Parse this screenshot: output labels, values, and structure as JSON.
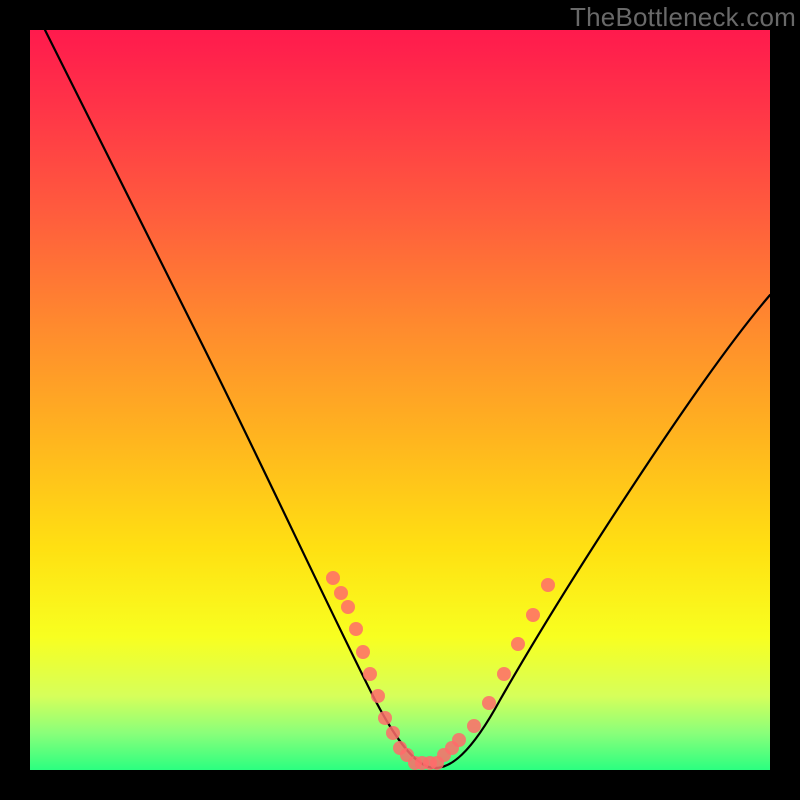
{
  "watermark": "TheBottleneck.com",
  "chart_data": {
    "type": "line",
    "title": "",
    "xlabel": "",
    "ylabel": "",
    "xlim": [
      0,
      100
    ],
    "ylim": [
      0,
      100
    ],
    "background_gradient": {
      "type": "vertical",
      "stops": [
        {
          "pos": 0,
          "color": "#ff1a4d"
        },
        {
          "pos": 25,
          "color": "#ff5d3d"
        },
        {
          "pos": 55,
          "color": "#ffb41f"
        },
        {
          "pos": 82,
          "color": "#f8ff20"
        },
        {
          "pos": 100,
          "color": "#2bff80"
        }
      ]
    },
    "series": [
      {
        "name": "bottleneck-curve",
        "x": [
          2,
          8,
          14,
          20,
          26,
          32,
          38,
          43,
          47,
          50,
          53,
          56,
          60,
          64,
          70,
          78,
          86,
          94,
          100
        ],
        "y": [
          100,
          90,
          79,
          67,
          56,
          44,
          33,
          22,
          12,
          5,
          1,
          1,
          3,
          8,
          17,
          30,
          43,
          55,
          64
        ]
      }
    ],
    "scatter_overlay": {
      "name": "highlight-dots",
      "color": "#ff6b6b",
      "points": [
        {
          "x": 41,
          "y": 26
        },
        {
          "x": 42,
          "y": 24
        },
        {
          "x": 43,
          "y": 22
        },
        {
          "x": 44,
          "y": 19
        },
        {
          "x": 45,
          "y": 16
        },
        {
          "x": 46,
          "y": 13
        },
        {
          "x": 47,
          "y": 10
        },
        {
          "x": 48,
          "y": 7
        },
        {
          "x": 49,
          "y": 5
        },
        {
          "x": 50,
          "y": 3
        },
        {
          "x": 51,
          "y": 2
        },
        {
          "x": 52,
          "y": 1
        },
        {
          "x": 53,
          "y": 1
        },
        {
          "x": 54,
          "y": 1
        },
        {
          "x": 55,
          "y": 1
        },
        {
          "x": 56,
          "y": 2
        },
        {
          "x": 57,
          "y": 3
        },
        {
          "x": 58,
          "y": 4
        },
        {
          "x": 60,
          "y": 6
        },
        {
          "x": 62,
          "y": 9
        },
        {
          "x": 64,
          "y": 13
        },
        {
          "x": 66,
          "y": 17
        },
        {
          "x": 68,
          "y": 21
        },
        {
          "x": 70,
          "y": 25
        }
      ]
    }
  }
}
